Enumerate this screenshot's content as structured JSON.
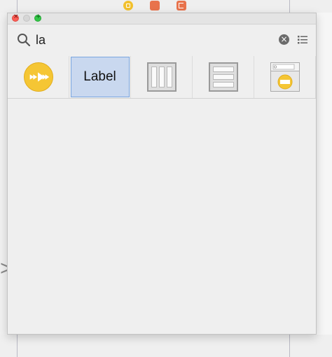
{
  "window": {
    "traffic_lights": [
      "close",
      "minimize",
      "zoom"
    ]
  },
  "search": {
    "value": "la",
    "placeholder": ""
  },
  "results": {
    "items": [
      {
        "icon": "av-player-view-icon",
        "label": ""
      },
      {
        "icon": "label-icon",
        "label": "Label",
        "selected": true
      },
      {
        "icon": "horizontal-stack-view-icon",
        "label": ""
      },
      {
        "icon": "vertical-stack-view-icon",
        "label": ""
      },
      {
        "icon": "text-input-placeholder-icon",
        "label": ""
      }
    ]
  },
  "colors": {
    "selection_fill": "#c9d8ef",
    "selection_border": "#7aa6e0",
    "accent_yellow": "#f5c634",
    "toolbar_orange": "#e8734c"
  }
}
